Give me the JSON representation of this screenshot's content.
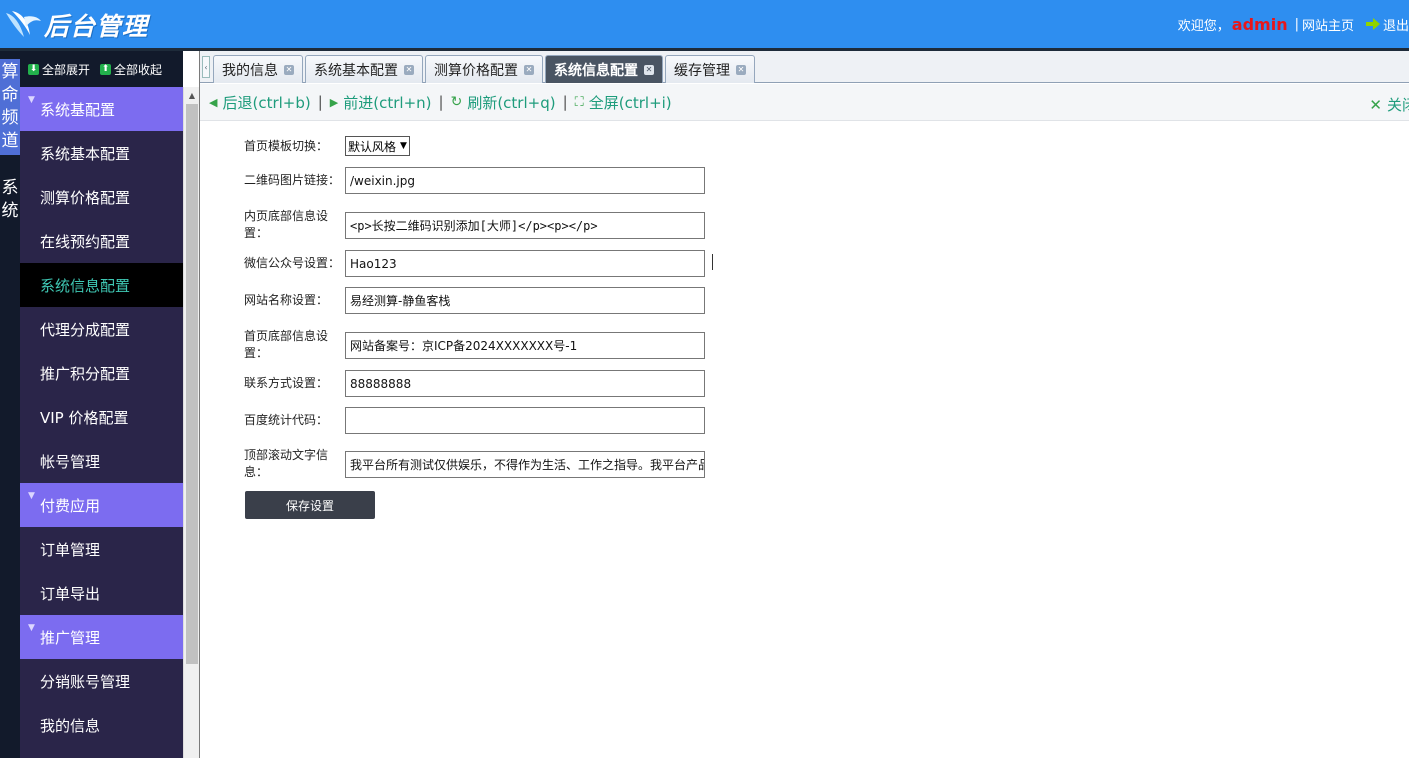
{
  "header": {
    "logo_text": "后台管理",
    "welcome": "欢迎您，",
    "admin_name": "admin",
    "home_link": "网站主页",
    "exit_link": "退出"
  },
  "vertical_tabs": [
    "算命频道",
    "系统"
  ],
  "sidebar": {
    "expand_all": "全部展开",
    "collapse_all": "全部收起",
    "sections": [
      {
        "title": "系统基配置",
        "items": [
          "系统基本配置",
          "测算价格配置",
          "在线预约配置",
          "系统信息配置",
          "代理分成配置",
          "推广积分配置",
          "VIP 价格配置",
          "帐号管理"
        ]
      },
      {
        "title": "付费应用",
        "items": [
          "订单管理",
          "订单导出"
        ]
      },
      {
        "title": "推广管理",
        "items": [
          "分销账号管理",
          "我的信息"
        ]
      }
    ],
    "active_item": "系统信息配置"
  },
  "tabs": [
    "我的信息",
    "系统基本配置",
    "测算价格配置",
    "系统信息配置",
    "缓存管理"
  ],
  "active_tab": "系统信息配置",
  "toolbar": {
    "back": "后退(ctrl+b)",
    "forward": "前进(ctrl+n)",
    "refresh": "刷新(ctrl+q)",
    "fullscreen": "全屏(ctrl+i)",
    "close": "关闭"
  },
  "form": {
    "template_label": "首页模板切换：",
    "template_value": "默认风格",
    "qrcode_label": "二维码图片链接：",
    "qrcode_value": "/weixin.jpg",
    "inner_footer_label": "内页底部信息设置：",
    "inner_footer_value": "<p>长按二维码识别添加[大师]</p><p></p>",
    "wechat_label": "微信公众号设置：",
    "wechat_value": "Hao123",
    "site_name_label": "网站名称设置：",
    "site_name_value": "易经测算-静鱼客栈",
    "home_footer_label": "首页底部信息设置：",
    "home_footer_value": "网站备案号：京ICP备2024XXXXXXX号-1",
    "contact_label": "联系方式设置：",
    "contact_value": "88888888",
    "baidu_label": "百度统计代码：",
    "baidu_value": "",
    "marquee_label": "顶部滚动文字信息：",
    "marquee_value": "我平台所有测试仅供娱乐，不得作为生活、工作之指导。我平台产品",
    "save_button": "保存设置"
  },
  "colors": {
    "header_bg": "#2e8ef0",
    "sidebar_bg": "#2a2549",
    "group_bg": "#7c6cf0",
    "active_text": "#3fc8b4",
    "toolbar_text": "#1e9c7c",
    "admin_red": "#e8161b"
  }
}
